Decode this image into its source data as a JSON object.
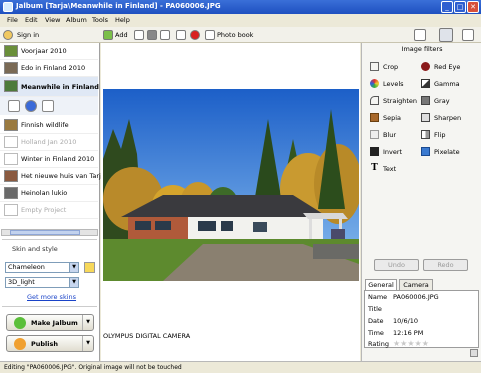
{
  "window": {
    "title": "Jalbum [Tarja\\Meanwhile in Finland] - PA060006.JPG",
    "controls": [
      "_",
      "□",
      "✕"
    ]
  },
  "menu": [
    "File",
    "Edit",
    "View",
    "Album",
    "Tools",
    "Help"
  ],
  "toolbar": {
    "sign_in": "Sign in",
    "add": "Add",
    "photo_book": "Photo book"
  },
  "albums": [
    {
      "label": "Voorjaar 2010",
      "dim": false,
      "thumb": "#6a8f3a"
    },
    {
      "label": "Edo in Finland 2010",
      "dim": false,
      "thumb": "#7a6a55"
    },
    {
      "label": "Meanwhile in Finland",
      "dim": false,
      "thumb": "#4d7a3a",
      "selected": true
    },
    {
      "label": "Finnish wildlife",
      "dim": false,
      "thumb": "#9a7a40"
    },
    {
      "label": "Holland Jan 2010",
      "dim": true,
      "thumb": "#ffffff"
    },
    {
      "label": "Winter in Finland 2010",
      "dim": false,
      "thumb": "#ffffff"
    },
    {
      "label": "Het nieuwe huis van Tarja",
      "dim": false,
      "thumb": "#8a5a40"
    },
    {
      "label": "Heinolan lukio",
      "dim": false,
      "thumb": "#6a6a6a"
    },
    {
      "label": "Empty Project",
      "dim": true,
      "thumb": "#ffffff"
    }
  ],
  "skin": {
    "section_label": "Skin and style",
    "skin_value": "Chameleon",
    "style_value": "3D_light",
    "more_skins_link": "Get more skins"
  },
  "actions": {
    "make_label": "Make Jalbum",
    "publish_label": "Publish"
  },
  "photo": {
    "caption": "OLYMPUS DIGITAL CAMERA"
  },
  "filters": {
    "title": "Image filters",
    "items": [
      {
        "label": "Crop",
        "icon": "crop-icon",
        "color": "#666666"
      },
      {
        "label": "Red Eye",
        "icon": "red-eye-icon",
        "color": "#8a1a1a"
      },
      {
        "label": "Levels",
        "icon": "levels-icon",
        "color": "#d03a3a"
      },
      {
        "label": "Gamma",
        "icon": "gamma-icon",
        "color": "#333333"
      },
      {
        "label": "Straighten",
        "icon": "straighten-icon",
        "color": "#555555"
      },
      {
        "label": "Gray",
        "icon": "gray-icon",
        "color": "#777777"
      },
      {
        "label": "Sepia",
        "icon": "sepia-icon",
        "color": "#a8682a"
      },
      {
        "label": "Sharpen",
        "icon": "sharpen-icon",
        "color": "#444444"
      },
      {
        "label": "Blur",
        "icon": "blur-icon",
        "color": "#999999"
      },
      {
        "label": "Flip",
        "icon": "flip-icon",
        "color": "#444444"
      },
      {
        "label": "Invert",
        "icon": "invert-icon",
        "color": "#222222"
      },
      {
        "label": "Pixelate",
        "icon": "pixelate-icon",
        "color": "#3a7ad0"
      },
      {
        "label": "Text",
        "icon": "text-icon",
        "color": "#222222"
      }
    ],
    "undo": "Undo",
    "redo": "Redo"
  },
  "info": {
    "tabs": [
      "General",
      "Camera"
    ],
    "rows": [
      {
        "label": "Name",
        "value": "PA060006.JPG"
      },
      {
        "label": "Title",
        "value": ""
      },
      {
        "label": "Date",
        "value": "10/6/10"
      },
      {
        "label": "Time",
        "value": "12:16 PM"
      },
      {
        "label": "Rating",
        "value": "★★★★★"
      }
    ]
  },
  "status": {
    "text": "Editing \"PA060006.JPG\". Original image will not be touched"
  }
}
